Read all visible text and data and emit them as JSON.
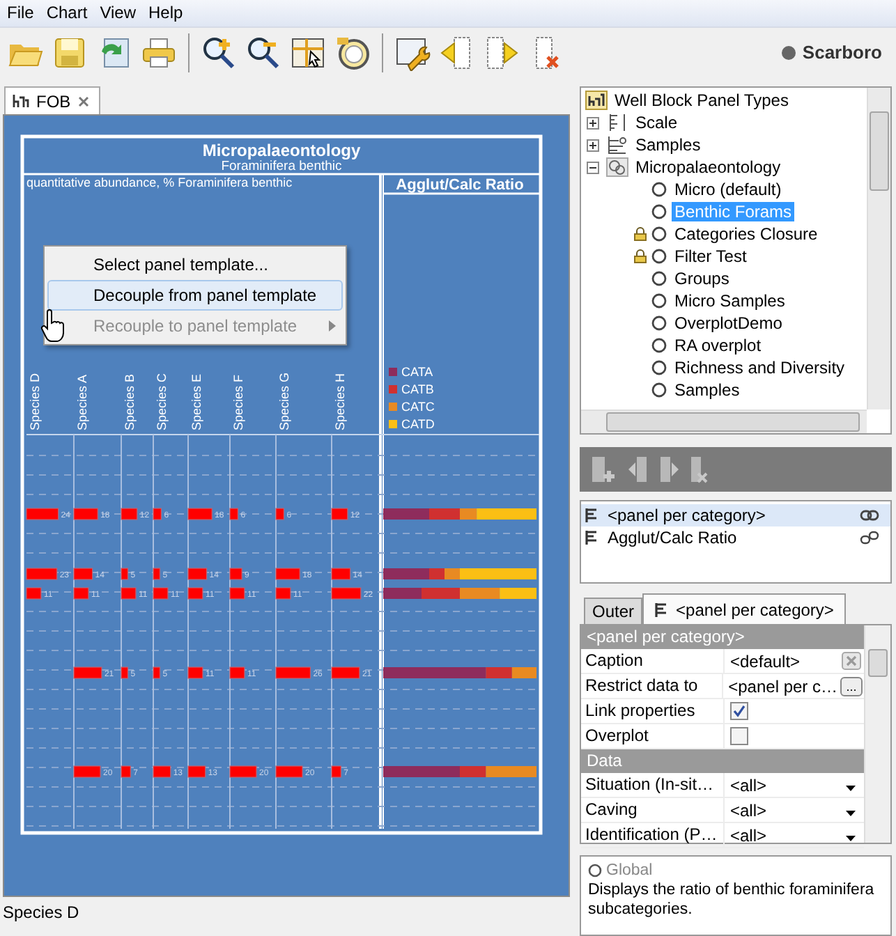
{
  "menu": [
    "File",
    "Chart",
    "View",
    "Help"
  ],
  "connection": {
    "label": "Scarboro"
  },
  "document_tab": {
    "label": "FOB",
    "selected": true
  },
  "chart": {
    "title": "Micropalaeontology",
    "subtitle": "Foraminifera benthic",
    "abundance_panel": {
      "caption": "quantitative abundance, % Foraminifera benthic",
      "columns": [
        {
          "title": "Species D",
          "values": [
            "24",
            "23",
            "11"
          ]
        },
        {
          "title": "Species A",
          "values": [
            "18",
            "14",
            "11",
            "21",
            "20"
          ]
        },
        {
          "title": "Species B",
          "values": [
            "12",
            "5",
            "11",
            "5",
            "7"
          ]
        },
        {
          "title": "Species C",
          "values": [
            "6",
            "5",
            "11",
            "5",
            "13"
          ]
        },
        {
          "title": "Species E",
          "values": [
            "18",
            "14",
            "11",
            "11",
            "13"
          ]
        },
        {
          "title": "Species F",
          "values": [
            "6",
            "9",
            "11",
            "11",
            "20"
          ]
        },
        {
          "title": "Species G",
          "values": [
            "6",
            "18",
            "11",
            "26",
            "20"
          ]
        },
        {
          "title": "Species H",
          "values": [
            "12",
            "14",
            "22",
            "21",
            "7"
          ]
        }
      ]
    },
    "ratio_panel": {
      "title": "Agglut/Calc Ratio",
      "legend": [
        {
          "label": "CATA",
          "color": "#8e2c5c"
        },
        {
          "label": "CATB",
          "color": "#d03030"
        },
        {
          "label": "CATC",
          "color": "#e88a22"
        },
        {
          "label": "CATD",
          "color": "#fbbf14"
        }
      ]
    }
  },
  "context_menu": {
    "items": [
      {
        "label": "Select panel template...",
        "selected": false,
        "disabled": false,
        "submenu": false
      },
      {
        "label": "Decouple from panel template",
        "selected": true,
        "disabled": false,
        "submenu": false
      },
      {
        "label": "Recouple to panel template",
        "selected": false,
        "disabled": true,
        "submenu": true
      }
    ]
  },
  "tree": {
    "label": "Well Block Panel Types",
    "kind": "root",
    "selected": false,
    "children": [
      {
        "label": "Scale",
        "kind": "scale",
        "selected": false,
        "expanded": false
      },
      {
        "label": "Samples",
        "kind": "samples",
        "selected": false,
        "expanded": false
      },
      {
        "label": "Micropalaeontology",
        "kind": "micro",
        "selected": false,
        "expanded": true,
        "children": [
          {
            "label": "Micro (default)",
            "kind": "template",
            "selected": false,
            "locked": false
          },
          {
            "label": "Benthic Forams",
            "kind": "template",
            "selected": true,
            "locked": false
          },
          {
            "label": "Categories Closure",
            "kind": "template",
            "selected": false,
            "locked": true
          },
          {
            "label": "Filter Test",
            "kind": "template",
            "selected": false,
            "locked": true
          },
          {
            "label": "Groups",
            "kind": "template",
            "selected": false,
            "locked": false
          },
          {
            "label": "Micro Samples",
            "kind": "template",
            "selected": false,
            "locked": false
          },
          {
            "label": "OverplotDemo",
            "kind": "template",
            "selected": false,
            "locked": false
          },
          {
            "label": "RA overplot",
            "kind": "template",
            "selected": false,
            "locked": false
          },
          {
            "label": "Richness and Diversity",
            "kind": "template",
            "selected": false,
            "locked": false
          },
          {
            "label": "Samples",
            "kind": "template",
            "selected": false,
            "locked": false
          }
        ]
      }
    ]
  },
  "panel_list": [
    {
      "label": "<panel per category>",
      "selected": true,
      "linked": true
    },
    {
      "label": "Agglut/Calc Ratio",
      "selected": false,
      "linked": false
    }
  ],
  "property_tabs": [
    {
      "label": "Outer",
      "selected": false
    },
    {
      "label": "<panel per category>",
      "selected": true
    }
  ],
  "properties": [
    {
      "kind": "section",
      "label": "<panel per category>"
    },
    {
      "kind": "text-clear",
      "name": "Caption",
      "value": "<default>"
    },
    {
      "kind": "text-browse",
      "name": "Restrict data to",
      "value": "<panel per c…",
      "button_label": "..."
    },
    {
      "kind": "checkbox",
      "name": "Link properties",
      "checked": true
    },
    {
      "kind": "checkbox",
      "name": "Overplot",
      "checked": false
    },
    {
      "kind": "section",
      "label": "Data"
    },
    {
      "kind": "dropdown",
      "name": "Situation (In-sit…",
      "value": "<all>"
    },
    {
      "kind": "dropdown",
      "name": "Caving",
      "value": "<all>"
    },
    {
      "kind": "dropdown",
      "name": "Identification (P…",
      "value": "<all>"
    }
  ],
  "description": {
    "scope": "Global",
    "text": "Displays the ratio of benthic foraminifera subcategories."
  },
  "status_bar": "Species D"
}
